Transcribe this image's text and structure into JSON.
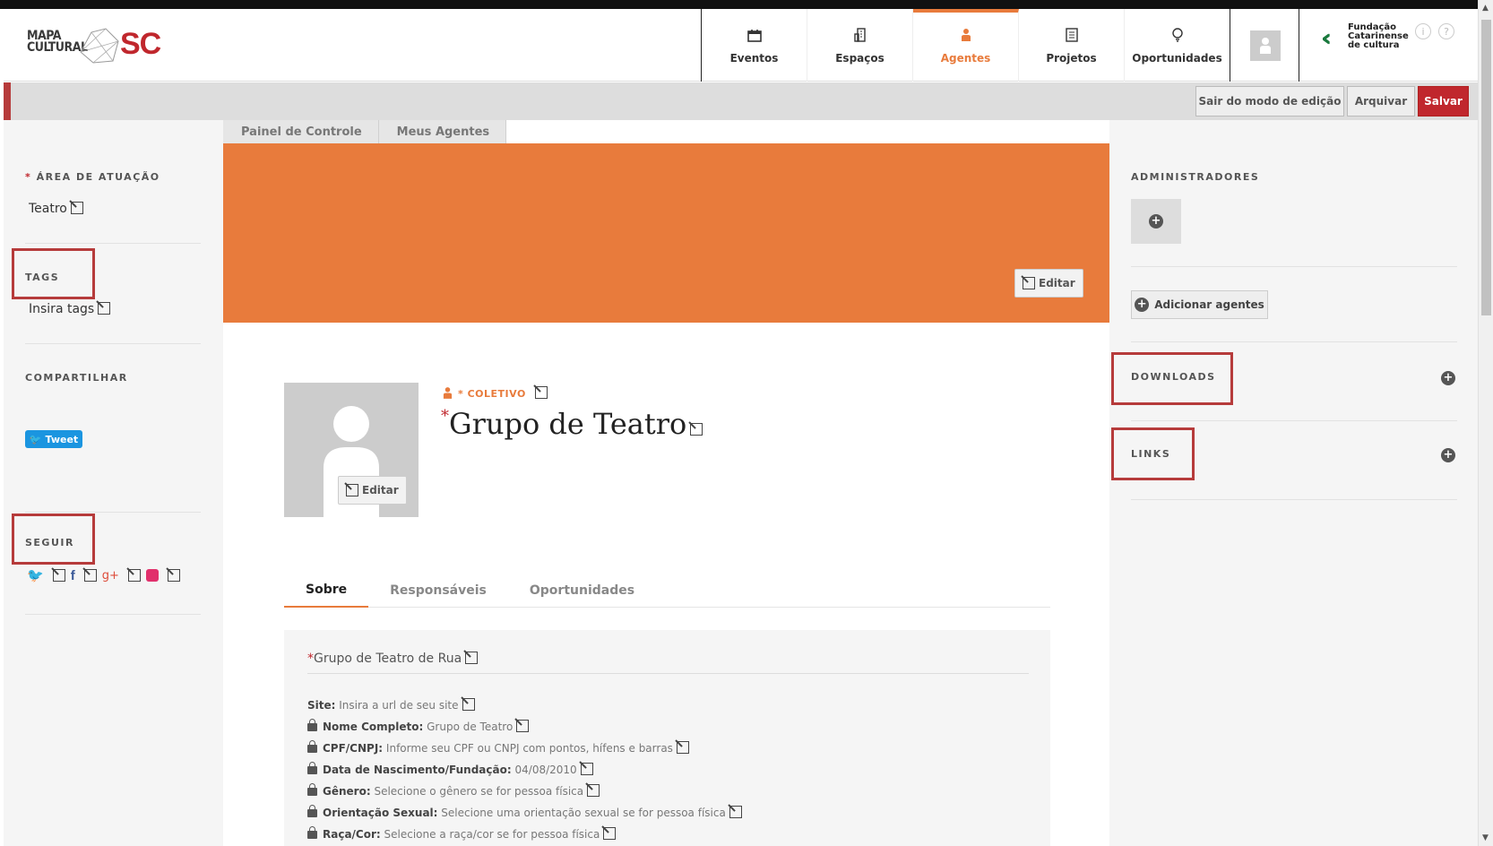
{
  "logo": {
    "line1": "MAPA",
    "line2": "CULTURAL",
    "suffix": "SC"
  },
  "nav": [
    {
      "label": "Eventos",
      "icon": "calendar-icon"
    },
    {
      "label": "Espaços",
      "icon": "building-icon"
    },
    {
      "label": "Agentes",
      "icon": "person-icon",
      "active": true
    },
    {
      "label": "Projetos",
      "icon": "document-icon"
    },
    {
      "label": "Oportunidades",
      "icon": "lightbulb-icon"
    }
  ],
  "partner": {
    "line1": "Fundação",
    "line2": "Catarinense",
    "line3": "de cultura"
  },
  "editbar": {
    "exit": "Sair do modo de edição",
    "archive": "Arquivar",
    "save": "Salvar"
  },
  "breadcrumbs": [
    "Painel de Controle",
    "Meus Agentes"
  ],
  "left": {
    "area_title": "ÁREA DE ATUAÇÃO",
    "area_required": "*",
    "area_value": "Teatro",
    "tags_title": "TAGS",
    "tags_placeholder": "Insira tags",
    "share_title": "COMPARTILHAR",
    "tweet_label": "Tweet",
    "follow_title": "SEGUIR"
  },
  "cover": {
    "edit_label": "Editar"
  },
  "agent": {
    "avatar_edit_label": "Editar",
    "type_required": "*",
    "type": "COLETIVO",
    "name_required": "*",
    "name": "Grupo de Teatro"
  },
  "tabs": [
    "Sobre",
    "Responsáveis",
    "Oportunidades"
  ],
  "about": {
    "short_required": "*",
    "short_description": "Grupo de Teatro de Rua",
    "fields": [
      {
        "label": "Site:",
        "value": "Insira a url de seu site",
        "locked": false
      },
      {
        "label": "Nome Completo:",
        "value": "Grupo de Teatro",
        "locked": true
      },
      {
        "label": "CPF/CNPJ:",
        "value": "Informe seu CPF ou CNPJ com pontos, hífens e barras",
        "locked": true
      },
      {
        "label": "Data de Nascimento/Fundação:",
        "value": "04/08/2010",
        "locked": true
      },
      {
        "label": "Gênero:",
        "value": "Selecione o gênero se for pessoa física",
        "locked": true
      },
      {
        "label": "Orientação Sexual:",
        "value": "Selecione uma orientação sexual se for pessoa física",
        "locked": true
      },
      {
        "label": "Raça/Cor:",
        "value": "Selecione a raça/cor se for pessoa física",
        "locked": true
      }
    ]
  },
  "right": {
    "admins_title": "ADMINISTRADORES",
    "add_agents_label": "Adicionar agentes",
    "downloads_title": "DOWNLOADS",
    "links_title": "LINKS"
  },
  "colors": {
    "accent": "#e87b3c",
    "brand_red": "#c0272d",
    "highlight": "#b63b3b"
  }
}
